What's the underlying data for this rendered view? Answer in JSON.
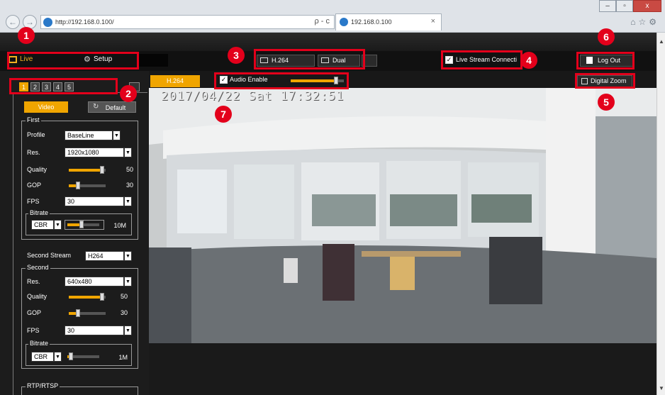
{
  "browser": {
    "url": "http://192.168.0.100/",
    "search_glyphs": "ρ - c",
    "tab_title": "192.168.0.100",
    "tab_close": "×",
    "back_glyph": "←",
    "forward_glyph": "→",
    "right_icons": "⌂☆⚙",
    "win_min": "–",
    "win_max": "▫",
    "win_close": "x"
  },
  "topbar": {
    "live_label": "Live",
    "setup_label": "Setup",
    "h264_label": "H.264",
    "dual_label": "Dual",
    "live_stream_label": "Live Stream Connecti",
    "logout_label": "Log Out",
    "digital_zoom_label": "Digital Zoom"
  },
  "viewbar": {
    "codec_tab": "H.264",
    "audio_label": "Audio Enable",
    "audio_level": 0.85,
    "osd_time": "2017/04/22 Sat 17:32:51"
  },
  "sidebar": {
    "channels": [
      "1",
      "2",
      "3",
      "4",
      "5"
    ],
    "video_button": "Video",
    "default_button": "Default",
    "first": {
      "title": "First",
      "profile_label": "Profile",
      "profile_value": "BaseLine",
      "res_label": "Res.",
      "res_value": "1920x1080",
      "quality_label": "Quality",
      "quality_value": "50",
      "quality_level": 0.9,
      "gop_label": "GOP",
      "gop_value": "30",
      "gop_level": 0.25,
      "fps_label": "FPS",
      "fps_value": "30",
      "bitrate_title": "Bitrate",
      "bitrate_mode": "CBR",
      "bitrate_value": "10M",
      "bitrate_level": 0.45
    },
    "second_stream_label": "Second Stream",
    "second_stream_codec": "H264",
    "second": {
      "title": "Second",
      "res_label": "Res.",
      "res_value": "640x480",
      "quality_label": "Quality",
      "quality_value": "50",
      "quality_level": 0.9,
      "gop_label": "GOP",
      "gop_value": "30",
      "gop_level": 0.25,
      "fps_label": "FPS",
      "fps_value": "30",
      "bitrate_title": "Bitrate",
      "bitrate_mode": "CBR",
      "bitrate_value": "1M",
      "bitrate_level": 0.1
    },
    "rtp_title": "RTP/RTSP"
  },
  "annotations": [
    "1",
    "2",
    "3",
    "4",
    "5",
    "6",
    "7"
  ],
  "colors": {
    "accent": "#f0a500",
    "annotation": "#e3001b"
  }
}
